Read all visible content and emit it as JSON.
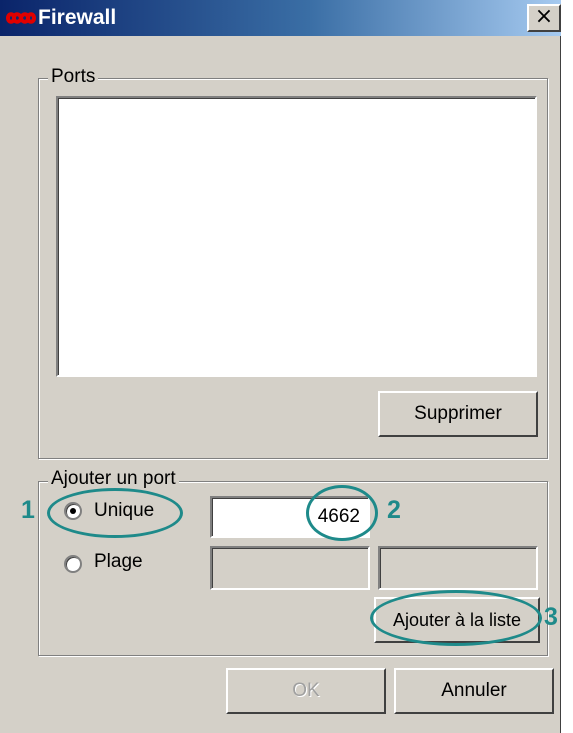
{
  "window": {
    "title": "Firewall",
    "close_glyph": "×",
    "icon": "infinity-icon",
    "accent": "#0a246a",
    "icon_color": "#e00000"
  },
  "ports_group": {
    "label": "Ports",
    "delete_button": "Supprimer"
  },
  "add_group": {
    "label": "Ajouter un port",
    "single_radio": "Unique",
    "single_selected": true,
    "range_radio": "Plage",
    "port_value": "4662",
    "range_from": "",
    "range_to": "",
    "add_button": "Ajouter à la liste"
  },
  "footer": {
    "ok_button": "OK",
    "cancel_button": "Annuler"
  },
  "annotations": {
    "color": "#1e8a8a",
    "step1": "1",
    "step2": "2",
    "step3": "3"
  }
}
